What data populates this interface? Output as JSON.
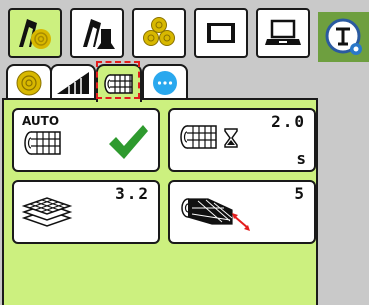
{
  "colors": {
    "active_bg": "#ccf07f",
    "panel_bg": "#ccf07f",
    "background": "#c9c9c9",
    "side_button": "#6e9f3f",
    "selection": "#e31d1d",
    "check": "#2e9a2e"
  },
  "top_toolbar": {
    "buttons": [
      {
        "icon": "round-baler-icon",
        "active": true
      },
      {
        "icon": "tractor-arm-icon",
        "active": false
      },
      {
        "icon": "bales-stack-icon",
        "active": false
      },
      {
        "icon": "display-screen-icon",
        "active": false
      },
      {
        "icon": "laptop-icon",
        "active": false
      }
    ],
    "side_button_icon": "implement-settings-icon"
  },
  "tabs": [
    {
      "icon": "bale-icon",
      "active": false
    },
    {
      "icon": "pickup-rake-icon",
      "active": false
    },
    {
      "icon": "net-wrap-icon",
      "active": true
    },
    {
      "icon": "more-icon",
      "active": false
    }
  ],
  "cards": {
    "auto_wrap": {
      "label": "AUTO",
      "checked": true
    },
    "wrap_delay": {
      "value": "2.0",
      "unit": "s"
    },
    "wrap_layers": {
      "value": "3.2"
    },
    "net_length": {
      "value": "5"
    }
  }
}
